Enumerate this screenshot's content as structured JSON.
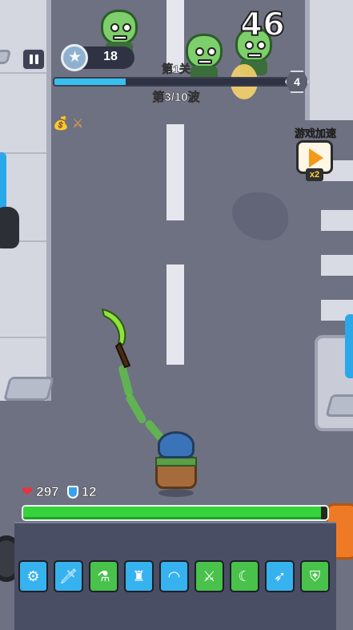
{
  "hud": {
    "score": "46",
    "gems": "18",
    "level_title": "第1关",
    "wave_text": "第3/10波",
    "wave_badge": "4",
    "wave_progress": 0.3
  },
  "speed_up": {
    "label": "游戏加速",
    "multiplier": "x2"
  },
  "player": {
    "hp": "297",
    "armor": "12",
    "hp_fraction": 0.98
  },
  "colors": {
    "hp_fill": "#37d33c",
    "wave_fill": "#36c0ef",
    "slot_blue": "#36b2ef",
    "slot_green": "#48c24b"
  },
  "weapon_slots": [
    {
      "icon": "gear-gun-icon",
      "glyph": "⚙",
      "tone": "blue"
    },
    {
      "icon": "dagger-icon",
      "glyph": "🗡",
      "tone": "blue"
    },
    {
      "icon": "bottle-icon",
      "glyph": "⚗",
      "tone": "green"
    },
    {
      "icon": "lantern-icon",
      "glyph": "♜",
      "tone": "blue"
    },
    {
      "icon": "boomerang-icon",
      "glyph": "◠",
      "tone": "blue"
    },
    {
      "icon": "spear-icon",
      "glyph": "⚔",
      "tone": "green"
    },
    {
      "icon": "sickle-icon",
      "glyph": "☾",
      "tone": "green"
    },
    {
      "icon": "rifle-icon",
      "glyph": "➶",
      "tone": "blue"
    },
    {
      "icon": "armor-icon",
      "glyph": "⛨",
      "tone": "green"
    }
  ]
}
